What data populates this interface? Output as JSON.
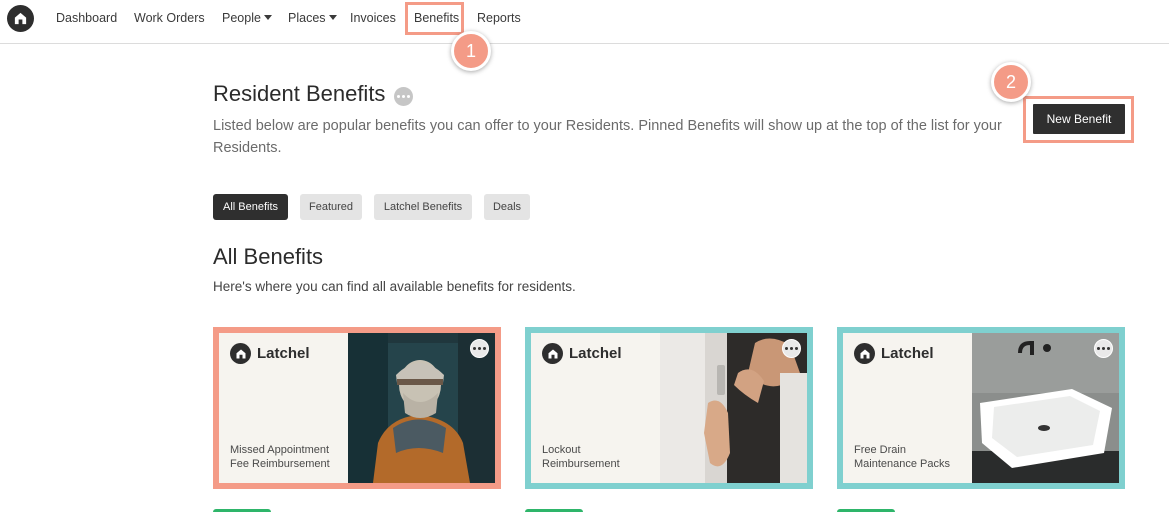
{
  "nav": {
    "items": [
      {
        "label": "Dashboard"
      },
      {
        "label": "Work Orders"
      },
      {
        "label": "People"
      },
      {
        "label": "Places"
      },
      {
        "label": "Invoices"
      },
      {
        "label": "Benefits"
      },
      {
        "label": "Reports"
      }
    ]
  },
  "steps": {
    "one": "1",
    "two": "2"
  },
  "header": {
    "title": "Resident Benefits",
    "description": "Listed below are popular benefits you can offer to your Residents. Pinned Benefits will show up at the top of the list for your Residents.",
    "new_button": "New Benefit"
  },
  "filters": [
    {
      "label": "All Benefits",
      "active": true
    },
    {
      "label": "Featured"
    },
    {
      "label": "Latchel Benefits"
    },
    {
      "label": "Deals"
    }
  ],
  "section": {
    "title": "All Benefits",
    "description": "Here's where you can find all available benefits for residents."
  },
  "cards": [
    {
      "brand": "Latchel",
      "title": "Missed Appointment Fee Reimbursement",
      "border_color": "#f49b87"
    },
    {
      "brand": "Latchel",
      "title": "Lockout Reimbursement",
      "border_color": "#7fd0cf"
    },
    {
      "brand": "Latchel",
      "title": "Free Drain Maintenance Packs",
      "border_color": "#7fd0cf"
    }
  ],
  "colors": {
    "highlight": "#f49b87",
    "teal": "#7fd0cf",
    "dark": "#2f2f2f",
    "green": "#2eb56a"
  },
  "icons": {
    "logo": "latchel-home-icon",
    "more": "more-horizontal-icon",
    "caret": "chevron-down-icon"
  }
}
